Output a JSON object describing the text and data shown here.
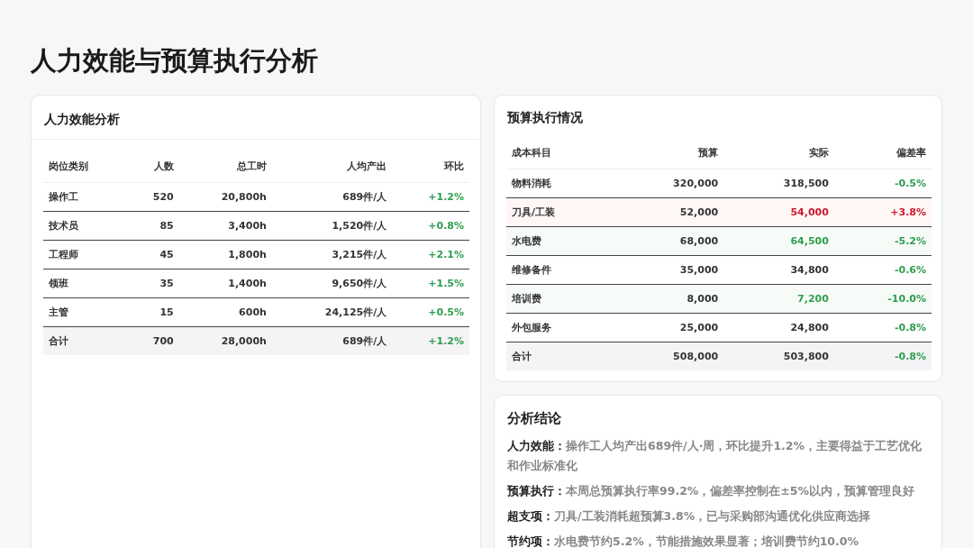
{
  "title": "人力效能与预算执行分析",
  "efficiency": {
    "title": "人力效能分析",
    "columns": [
      "岗位类别",
      "人数",
      "总工时",
      "人均产出",
      "环比"
    ],
    "rows": [
      {
        "cells": [
          "操作工",
          "520",
          "20,800h",
          "689件/人",
          "+1.2%"
        ],
        "kind": "item"
      },
      {
        "cells": [
          "技术员",
          "85",
          "3,400h",
          "1,520件/人",
          "+0.8%"
        ],
        "kind": "item"
      },
      {
        "cells": [
          "工程师",
          "45",
          "1,800h",
          "3,215件/人",
          "+2.1%"
        ],
        "kind": "item"
      },
      {
        "cells": [
          "领班",
          "35",
          "1,400h",
          "9,650件/人",
          "+1.5%"
        ],
        "kind": "item"
      },
      {
        "cells": [
          "主管",
          "15",
          "600h",
          "24,125件/人",
          "+0.5%"
        ],
        "kind": "item"
      },
      {
        "cells": [
          "合计",
          "700",
          "28,000h",
          "689件/人",
          "+1.2%"
        ],
        "kind": "total"
      }
    ]
  },
  "budget": {
    "title": "预算执行情况",
    "columns": [
      "成本科目",
      "预算",
      "实际",
      "偏差率"
    ],
    "rows": [
      {
        "cells": [
          "物料消耗",
          "320,000",
          "318,500",
          "-0.5%"
        ],
        "kind": "normal"
      },
      {
        "cells": [
          "刀具/工装",
          "52,000",
          "54,000",
          "+3.8%"
        ],
        "kind": "over"
      },
      {
        "cells": [
          "水电费",
          "68,000",
          "64,500",
          "-5.2%"
        ],
        "kind": "saving"
      },
      {
        "cells": [
          "维修备件",
          "35,000",
          "34,800",
          "-0.6%"
        ],
        "kind": "normal"
      },
      {
        "cells": [
          "培训费",
          "8,000",
          "7,200",
          "-10.0%"
        ],
        "kind": "saving"
      },
      {
        "cells": [
          "外包服务",
          "25,000",
          "24,800",
          "-0.8%"
        ],
        "kind": "normal"
      },
      {
        "cells": [
          "合计",
          "508,000",
          "503,800",
          "-0.8%"
        ],
        "kind": "total"
      }
    ]
  },
  "conclusions": {
    "title": "分析结论",
    "items": [
      {
        "label": "人力效能：",
        "text": "操作工人均产出689件/人·周，环比提升1.2%，主要得益于工艺优化和作业标准化"
      },
      {
        "label": "预算执行：",
        "text": "本周总预算执行率99.2%，偏差率控制在±5%以内，预算管理良好"
      },
      {
        "label": "超支项：",
        "text": "刀具/工装消耗超预算3.8%，已与采购部沟通优化供应商选择"
      },
      {
        "label": "节约项：",
        "text": "水电费节约5.2%，节能措施效果显著；培训费节约10.0%"
      }
    ]
  }
}
